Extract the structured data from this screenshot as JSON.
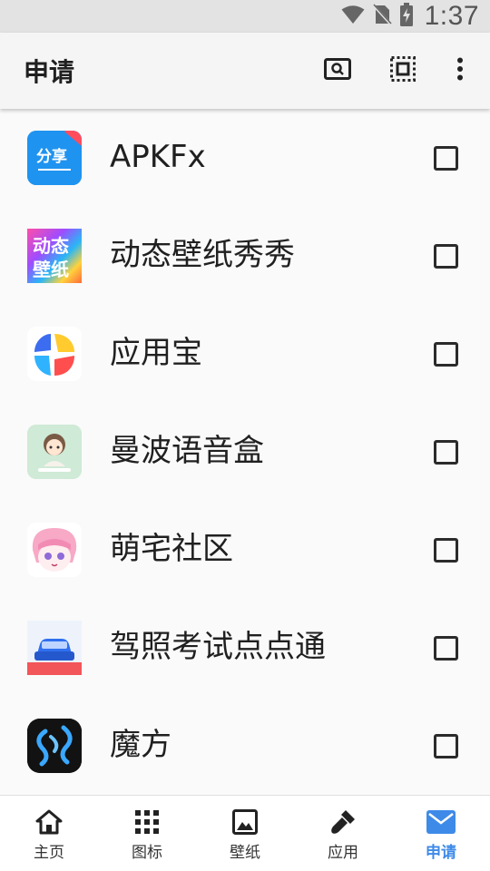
{
  "status_bar": {
    "time": "1:37",
    "icons": [
      "wifi-icon",
      "no-sim-icon",
      "battery-charging-icon"
    ]
  },
  "app_bar": {
    "title": "申请",
    "actions": [
      "search-image-icon",
      "select-all-icon",
      "more-vert-icon"
    ]
  },
  "apps": [
    {
      "name": "APKFx",
      "icon": "fenxiang-app-icon",
      "icon_text": "分享",
      "checked": false
    },
    {
      "name": "动态壁纸秀秀",
      "icon": "dongtai-bizhi-app-icon",
      "icon_text": "动态壁纸",
      "checked": false
    },
    {
      "name": "应用宝",
      "icon": "yingyongbao-app-icon",
      "checked": false
    },
    {
      "name": "曼波语音盒",
      "icon": "manbo-app-icon",
      "checked": false
    },
    {
      "name": "萌宅社区",
      "icon": "mengzhai-app-icon",
      "checked": false
    },
    {
      "name": "驾照考试点点通",
      "icon": "jiazhao-app-icon",
      "checked": false
    },
    {
      "name": "魔方",
      "icon": "mofang-app-icon",
      "checked": false
    }
  ],
  "bottom_nav": {
    "items": [
      {
        "label": "主页",
        "icon": "home-icon"
      },
      {
        "label": "图标",
        "icon": "grid-icon"
      },
      {
        "label": "壁纸",
        "icon": "image-icon"
      },
      {
        "label": "应用",
        "icon": "brush-icon"
      },
      {
        "label": "申请",
        "icon": "mail-icon"
      }
    ],
    "active_index": 4,
    "active_color": "#3e8ae8"
  }
}
